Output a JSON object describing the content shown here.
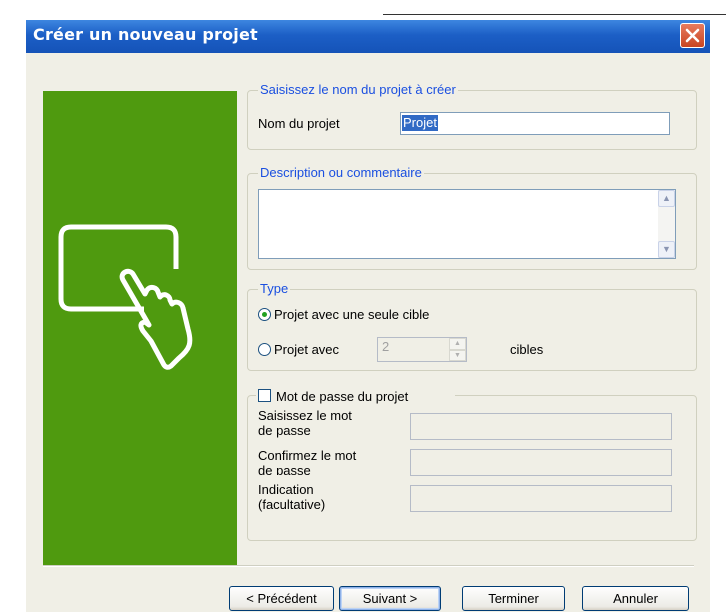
{
  "window": {
    "title": "Créer un nouveau projet"
  },
  "name_group": {
    "legend": "Saisissez le nom du projet à créer",
    "label": "Nom du projet",
    "value": "Projet"
  },
  "description_group": {
    "legend": "Description ou commentaire",
    "value": ""
  },
  "type_group": {
    "legend": "Type",
    "single_target_label": "Projet avec une seule cible",
    "multi_target_label": "Projet avec",
    "target_count": "2",
    "targets_suffix": "cibles",
    "selected": "single"
  },
  "password_group": {
    "checkbox_label": "Mot de passe du projet",
    "checked": false,
    "enter_label_1": "Saisissez le mot",
    "enter_label_2": "de passe",
    "confirm_label_1": "Confirmez le mot",
    "confirm_label_2": "de passe",
    "hint_label_1": "Indication",
    "hint_label_2": "(facultative)"
  },
  "buttons": {
    "previous": "< Précédent",
    "next": "Suivant >",
    "finish": "Terminer",
    "cancel": "Annuler"
  },
  "colors": {
    "title_bar": "#1c5fc6",
    "side_panel": "#4f9a0f",
    "legend_text": "#1a4fe0"
  }
}
